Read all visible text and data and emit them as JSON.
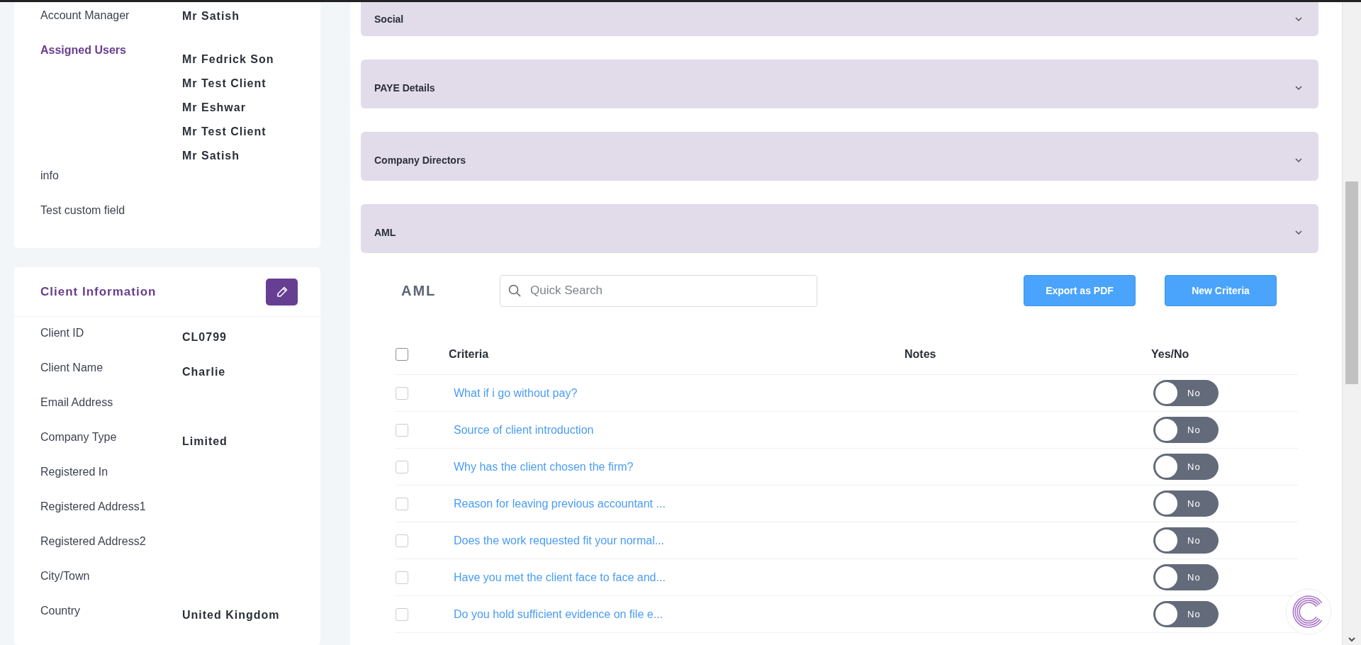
{
  "profile_fields": [
    {
      "label": "Account Manager",
      "kind": "plain",
      "values": [
        "Mr Satish"
      ]
    },
    {
      "label": "Assigned Users",
      "kind": "heading",
      "values": [
        "Mr Fedrick Son",
        "Mr Test Client",
        "Mr Eshwar",
        "Mr Test Client",
        "Mr Satish"
      ]
    },
    {
      "label": "info",
      "kind": "plain"
    },
    {
      "label": "Test custom field",
      "kind": "plain"
    }
  ],
  "client_information": {
    "title": "Client Information",
    "fields": [
      {
        "label": "Client ID",
        "value": "CL0799"
      },
      {
        "label": "Client Name",
        "value": "Charlie"
      },
      {
        "label": "Email Address"
      },
      {
        "label": "Company Type",
        "value": "Limited"
      },
      {
        "label": "Registered In"
      },
      {
        "label": "Registered Address1"
      },
      {
        "label": "Registered Address2"
      },
      {
        "label": "City/Town"
      },
      {
        "label": "Country",
        "value": "United Kingdom"
      }
    ]
  },
  "accordions": [
    {
      "title": "Social"
    },
    {
      "title": "PAYE Details"
    },
    {
      "title": "Company Directors"
    },
    {
      "title": "AML"
    }
  ],
  "aml": {
    "title": "AML",
    "search": {
      "placeholder": "Quick Search"
    },
    "buttons": [
      "Export as PDF",
      "New Criteria"
    ],
    "columns": [
      "Criteria",
      "Notes",
      "Yes/No"
    ],
    "all_checked": false,
    "rows": [
      {
        "criteria": "What if i go without pay?",
        "checked": false,
        "on": false,
        "answer": "No"
      },
      {
        "criteria": "Source of client introduction",
        "checked": false,
        "on": false,
        "answer": "No"
      },
      {
        "criteria": "Why has the client chosen the firm?",
        "checked": false,
        "on": false,
        "answer": "No"
      },
      {
        "criteria": "Reason for leaving previous accountant ...",
        "checked": false,
        "on": false,
        "answer": "No"
      },
      {
        "criteria": "Does the work requested fit your normal...",
        "checked": false,
        "on": false,
        "answer": "No"
      },
      {
        "criteria": "Have you met the client face to face and...",
        "checked": false,
        "on": false,
        "answer": "No"
      },
      {
        "criteria": "Do you hold sufficient evidence on file e...",
        "checked": false,
        "on": false,
        "answer": "No"
      }
    ]
  }
}
